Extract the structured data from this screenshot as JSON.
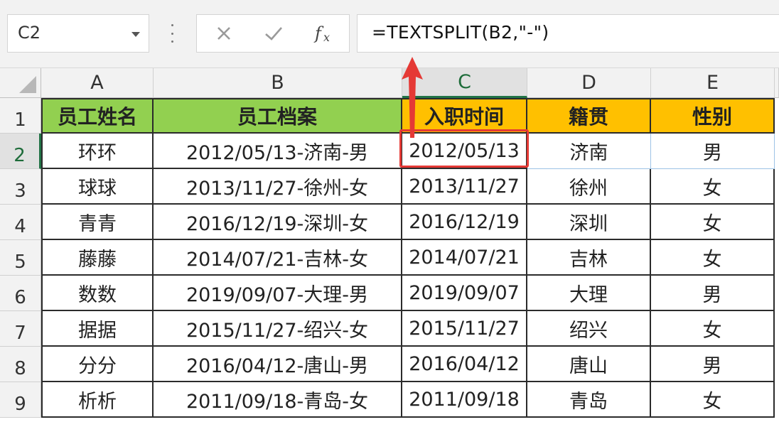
{
  "formula_bar": {
    "name_box": "C2",
    "formula": "=TEXTSPLIT(B2,\"-\")",
    "icons": [
      "cancel-x-icon",
      "enter-check-icon",
      "insert-function-icon"
    ]
  },
  "sheet": {
    "columns": [
      "A",
      "B",
      "C",
      "D",
      "E"
    ],
    "selected_column": "C",
    "rows": [
      "1",
      "2",
      "3",
      "4",
      "5",
      "6",
      "7",
      "8",
      "9"
    ],
    "selected_row": "2",
    "header_cells": [
      "员工姓名",
      "员工档案",
      "入职时间",
      "籍贯",
      "性别"
    ],
    "data": [
      [
        "环环",
        "2012/05/13-济南-男",
        "2012/05/13",
        "济南",
        "男"
      ],
      [
        "球球",
        "2013/11/27-徐州-女",
        "2013/11/27",
        "徐州",
        "女"
      ],
      [
        "青青",
        "2016/12/19-深圳-女",
        "2016/12/19",
        "深圳",
        "女"
      ],
      [
        "藤藤",
        "2014/07/21-吉林-女",
        "2014/07/21",
        "吉林",
        "女"
      ],
      [
        "数数",
        "2019/09/07-大理-男",
        "2019/09/07",
        "大理",
        "男"
      ],
      [
        "据据",
        "2015/11/27-绍兴-女",
        "2015/11/27",
        "绍兴",
        "女"
      ],
      [
        "分分",
        "2016/04/12-唐山-男",
        "2016/04/12",
        "唐山",
        "男"
      ],
      [
        "析析",
        "2011/09/18-青岛-女",
        "2011/09/18",
        "青岛",
        "女"
      ]
    ]
  },
  "colors": {
    "header_green": "#92d050",
    "header_gold": "#ffc000",
    "annotation_red": "#e53935",
    "excel_green": "#217346"
  }
}
